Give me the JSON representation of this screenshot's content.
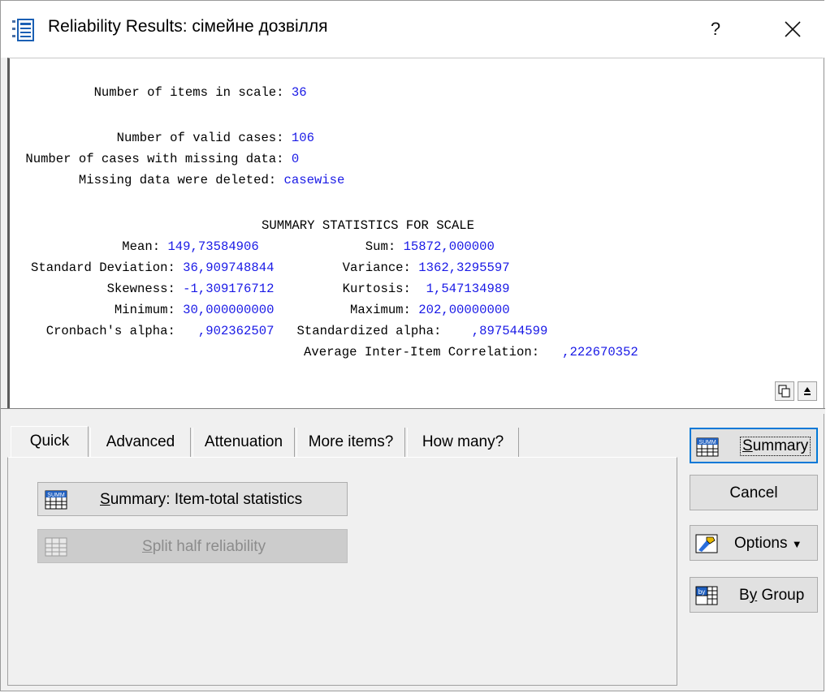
{
  "window": {
    "title": "Reliability Results: сімейне дозвілля",
    "help_label": "?",
    "close_glyph": "✕"
  },
  "output": {
    "lines": [
      {
        "label": "          Number of items in scale: ",
        "value": "36"
      },
      {
        "label": "             Number of valid cases: ",
        "value": "106"
      },
      {
        "label": " Number of cases with missing data: ",
        "value": "0"
      },
      {
        "label": "        Missing data were deleted: ",
        "value": "casewise"
      }
    ],
    "summary_heading": "SUMMARY STATISTICS FOR SCALE",
    "stats": [
      {
        "l1": "            Mean: ",
        "v1": "149,73584906",
        "l2": "              Sum: ",
        "v2": "15872,000000"
      },
      {
        "l1": "Standard Deviation: ",
        "v1": "36,909748844",
        "l2": "         Variance: ",
        "v2": "1362,3295597"
      },
      {
        "l1": "          Skewness: ",
        "v1": "-1,309176712",
        "l2": "         Kurtosis:  ",
        "v2": "1,547134989"
      },
      {
        "l1": "           Minimum: ",
        "v1": "30,000000000",
        "l2": "          Maximum: ",
        "v2": "202,00000000"
      }
    ],
    "alpha_label": "  Cronbach's alpha:  ",
    "alpha_value": " ,902362507",
    "std_alpha_label": "   Standardized alpha:   ",
    "std_alpha_value": " ,897544599",
    "avg_corr_label": "Average Inter-Item Correlation:  ",
    "avg_corr_value": " ,222670352"
  },
  "tabs": [
    {
      "label": "Quick"
    },
    {
      "label": "Advanced"
    },
    {
      "label": "Attenuation"
    },
    {
      "label": "More items?"
    },
    {
      "label": "How many?"
    }
  ],
  "quick": {
    "summary_btn_prefix": "S",
    "summary_btn_rest": "ummary:  Item-total statistics",
    "split_btn_prefix": "S",
    "split_btn_rest": "plit half reliability"
  },
  "side": {
    "summary_prefix": "S",
    "summary_rest": "ummary",
    "cancel": "Cancel",
    "options": "Options",
    "options_arrow": "▼",
    "bygroup_pre": "B",
    "bygroup_u": "y",
    "bygroup_rest": " Group"
  },
  "icons": {
    "window_icon": "document-list-icon",
    "summary_icon": "summary-table-icon",
    "split_icon": "split-table-icon",
    "options_icon": "options-tool-icon",
    "bygroup_icon": "by-group-icon",
    "copy_icon": "copy-icon",
    "expand_icon": "expand-up-icon"
  }
}
